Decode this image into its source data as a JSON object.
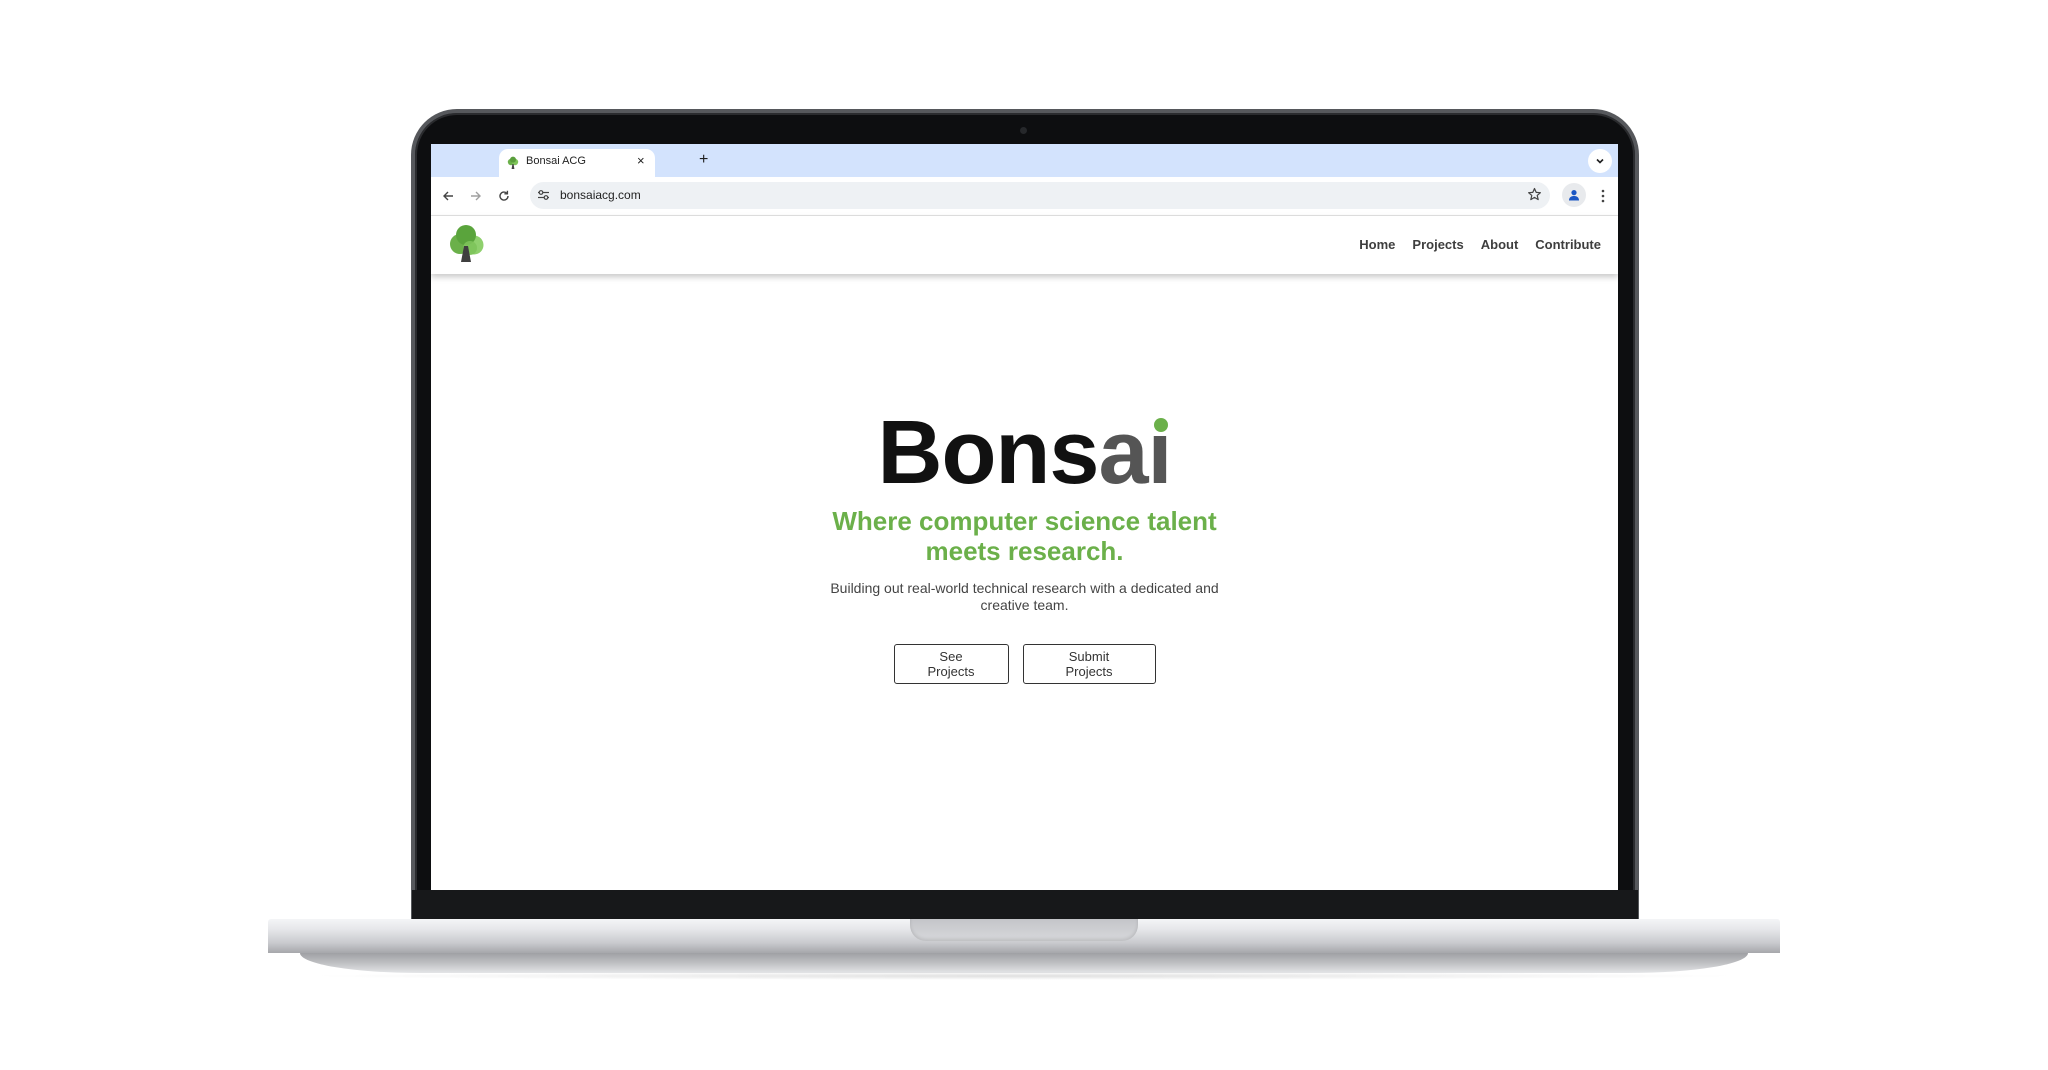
{
  "browser": {
    "tab_title": "Bonsai ACG",
    "tab_close": "×",
    "new_tab": "+",
    "url": "bonsaiacg.com",
    "icons": [
      "tab-favicon-icon",
      "close-icon",
      "plus-icon",
      "chevron-down-icon",
      "back-arrow-icon",
      "forward-arrow-icon",
      "reload-icon",
      "site-settings-icon",
      "star-icon",
      "profile-icon",
      "more-vert-icon"
    ]
  },
  "site": {
    "logo": "bonsai-tree-logo",
    "nav": [
      "Home",
      "Projects",
      "About",
      "Contribute"
    ],
    "hero": {
      "title_dark": "Bons",
      "title_grey": "a",
      "title_i": "i",
      "tagline": "Where computer science talent meets research.",
      "description": "Building out real-world technical research with a dedicated and creative team.",
      "buttons": [
        "See Projects",
        "Submit Projects"
      ]
    }
  },
  "colors": {
    "accent_green": "#6bb04a",
    "tabstrip": "#d3e3fd",
    "title_dark": "#111111",
    "title_grey": "#555555"
  }
}
